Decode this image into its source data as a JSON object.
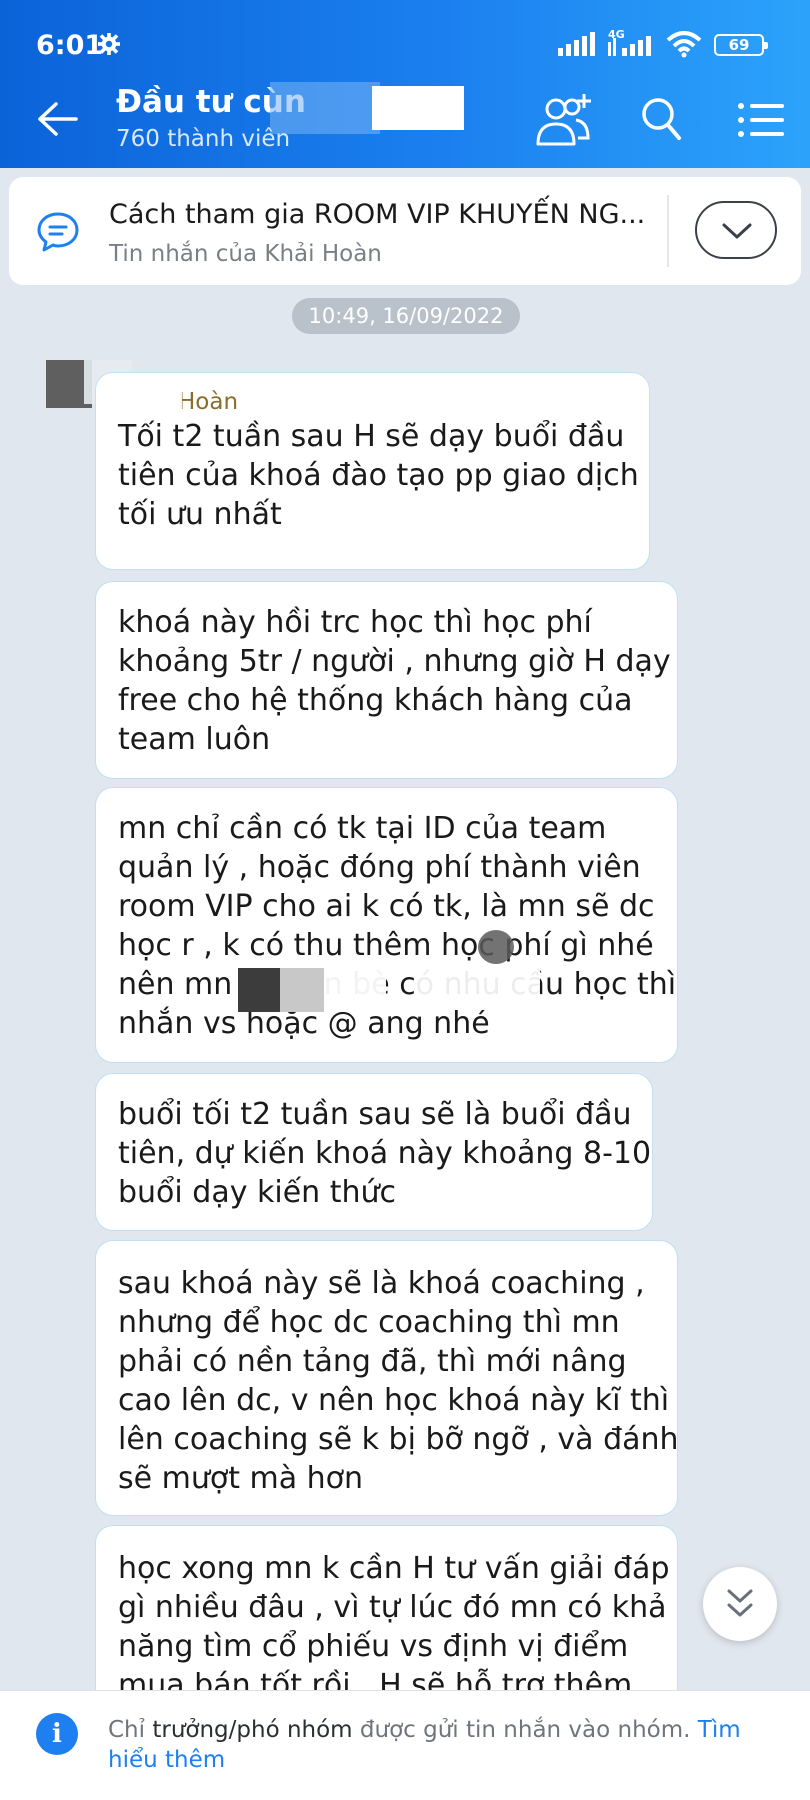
{
  "status": {
    "time": "6:01",
    "network": "4G",
    "battery": "69"
  },
  "header": {
    "title": "Đầu tư cùn",
    "members": "760 thành viên"
  },
  "pinned": {
    "title": "Cách tham gia ROOM VIP KHUYẾN NG...",
    "subtitle": "Tin nhắn của Khải Hoàn"
  },
  "chat": {
    "timestamp": "10:49, 16/09/2022",
    "messages": [
      {
        "sender": "Hoàn",
        "lines": [
          "Tối t2 tuần sau H sẽ dạy buổi đầu",
          "tiên của khoá đào tạo pp giao dịch",
          "tối ưu nhất"
        ]
      },
      {
        "lines": [
          "khoá này hồi trc học thì học phí",
          "khoảng 5tr / người , nhưng giờ H dạy",
          "free cho hệ thống khách hàng của",
          "team luôn"
        ]
      },
      {
        "lines": [
          "mn chỉ cần có tk tại ID của team",
          "quản lý , hoặc đóng phí thành viên",
          "room VIP cho ai k có tk, là mn sẽ dc",
          "học r , k có thu thêm học phí gì nhé",
          "nên mn có bạn bè có nhu cầu học thì",
          "nhắn vs hoặc @ ang nhé"
        ]
      },
      {
        "lines": [
          "buổi tối t2 tuần sau sẽ là buổi đầu",
          "tiên, dự kiến khoá này khoảng 8-10",
          "buổi dạy kiến thức"
        ]
      },
      {
        "lines": [
          "sau khoá này sẽ là khoá coaching ,",
          "nhưng để học dc coaching thì mn",
          "phải có nền tảng đã, thì mới nâng",
          "cao lên dc, v nên học khoá này kĩ thì",
          "lên coaching sẽ k bị bỡ ngỡ , và đánh",
          "sẽ mượt mà hơn"
        ]
      },
      {
        "lines": [
          "học xong mn k cần H tư vấn giải đáp",
          "gì nhiều đâu , vì tự lúc đó mn có khả",
          "năng tìm cổ phiếu vs định vị điểm",
          "mua bán tốt rồi , H sẽ hỗ trợ thêm"
        ]
      }
    ]
  },
  "notice": {
    "prefix": "Chỉ ",
    "role": "trưởng/phó nhóm",
    "middle": " được gửi tin nhắn vào nhóm. ",
    "link": "Tìm hiểu thêm"
  },
  "colors": {
    "header_start": "#0b63d8",
    "header_end": "#2ca3fb",
    "accent": "#1d7ff0",
    "chat_bg": "#e1e7ef"
  }
}
